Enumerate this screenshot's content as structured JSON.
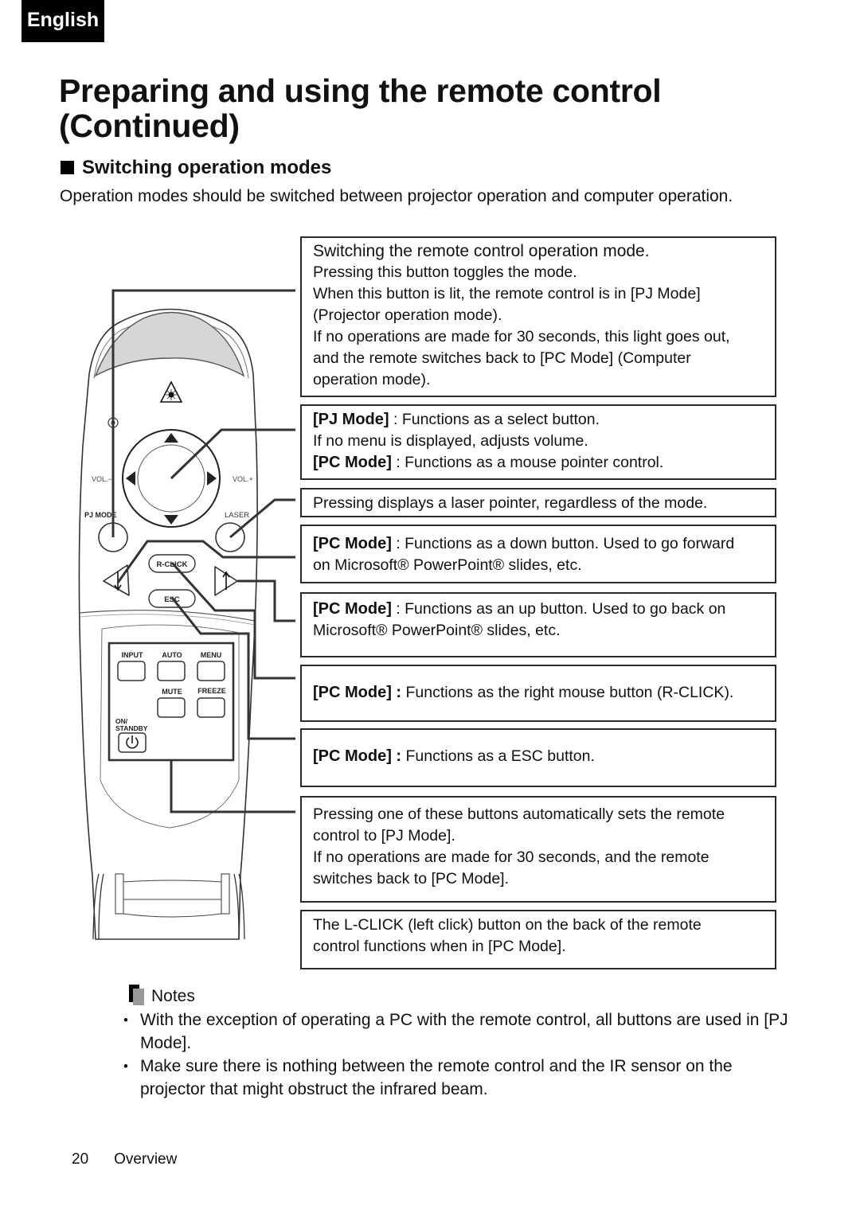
{
  "language_tab": "English",
  "title_line1": "Preparing and using the remote control",
  "title_line2": "(Continued)",
  "section_heading": "Switching operation modes",
  "intro": "Operation modes should be switched between projector operation and computer operation.",
  "remote": {
    "labels": {
      "vol_minus": "VOL.−",
      "vol_plus": "VOL.+",
      "pj_mode": "PJ MODE",
      "laser": "LASER",
      "r_click": "R-CLICK",
      "esc": "ESC",
      "input": "INPUT",
      "auto": "AUTO",
      "menu": "MENU",
      "mute": "MUTE",
      "freeze": "FREEZE",
      "on": "ON/",
      "standby": "STANDBY"
    }
  },
  "callouts": [
    {
      "lines": [
        "Switching the remote control operation mode.",
        "Pressing this button toggles the mode.",
        "When this button is lit, the remote control is in [PJ Mode]",
        "(Projector operation mode).",
        "If no operations are made for 30 seconds, this light goes out,",
        "and the remote switches back to [PC Mode] (Computer",
        "operation mode)."
      ]
    },
    {
      "pj_label": "[PJ Mode]",
      "pj_text": " : Functions as a select button.",
      "line2": "If no menu is displayed, adjusts volume.",
      "pc_label": "[PC Mode]",
      "pc_text": " : Functions as a mouse pointer control."
    },
    {
      "text": "Pressing displays a laser pointer, regardless of the mode."
    },
    {
      "pc_label": "[PC Mode]",
      "pc_text": " : Functions as a down button. Used to go forward",
      "line2": "on Microsoft® PowerPoint® slides, etc."
    },
    {
      "pc_label": "[PC Mode]",
      "pc_text": " : Functions as an up button. Used to go back on",
      "line2": "Microsoft® PowerPoint® slides, etc."
    },
    {
      "pc_label": "[PC Mode] :",
      "pc_text": " Functions as the right mouse button (R-CLICK)."
    },
    {
      "pc_label": "[PC Mode] :",
      "pc_text": " Functions as a ESC button."
    },
    {
      "lines": [
        "Pressing one of these buttons automatically sets the remote",
        "control to [PJ Mode].",
        "If no operations are made for 30 seconds, and the remote",
        "switches back to [PC Mode]."
      ]
    },
    {
      "lines": [
        "The L-CLICK (left click) button on the back of the remote",
        "control functions when in [PC Mode]."
      ]
    }
  ],
  "notes": {
    "heading": "Notes",
    "items": [
      "With the exception of operating a PC with the remote control, all buttons are used in [PJ Mode].",
      "Make sure there is nothing between the remote control and the IR sensor on the projector that might obstruct the infrared beam."
    ]
  },
  "footer": {
    "page_number": "20",
    "section": "Overview"
  }
}
